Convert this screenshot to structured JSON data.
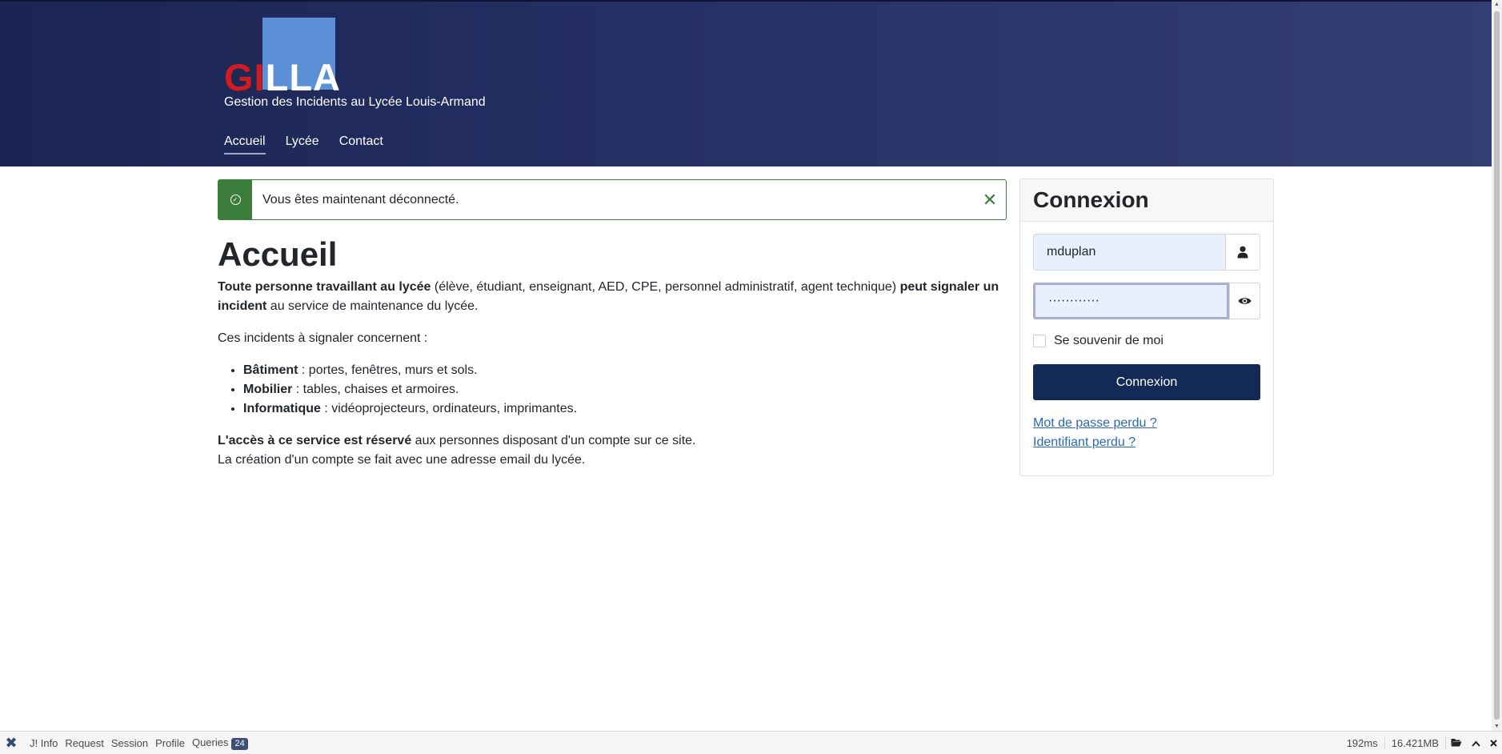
{
  "header": {
    "logo_part1": "GI",
    "logo_part2": "LLA",
    "site_description": "Gestion des Incidents au Lycée Louis-Armand",
    "nav": [
      "Accueil",
      "Lycée",
      "Contact"
    ]
  },
  "alert": {
    "message": "Vous êtes maintenant déconnecté.",
    "close": "✕"
  },
  "main": {
    "title": "Accueil",
    "p1_bold1": "Toute personne travaillant au lycée",
    "p1_text1": " (élève, étudiant, enseignant, AED, CPE, personnel administratif, agent technique) ",
    "p1_bold2": "peut signaler un incident",
    "p1_text2": " au service de maintenance du lycée.",
    "p2": "Ces incidents à signaler concernent :",
    "list": [
      {
        "bold": "Bâtiment",
        "text": " : portes, fenêtres, murs et sols."
      },
      {
        "bold": "Mobilier",
        "text": " : tables, chaises et armoires."
      },
      {
        "bold": "Informatique",
        "text": " : vidéoprojecteurs, ordinateurs, imprimantes."
      }
    ],
    "p3_bold": "L'accès à ce service est réservé",
    "p3_text": " aux personnes disposant d'un compte sur ce site.",
    "p4": "La création d'un compte se fait avec une adresse email du lycée."
  },
  "login": {
    "title": "Connexion",
    "username_value": "mduplan",
    "password_value": "············",
    "remember_label": "Se souvenir de moi",
    "submit_label": "Connexion",
    "lost_password": "Mot de passe perdu ?",
    "lost_username": "Identifiant perdu ?"
  },
  "debugbar": {
    "logo": "✖",
    "items": [
      "J! Info",
      "Request",
      "Session",
      "Profile",
      "Queries"
    ],
    "queries_count": "24",
    "time": "192ms",
    "memory": "16.421MB"
  }
}
